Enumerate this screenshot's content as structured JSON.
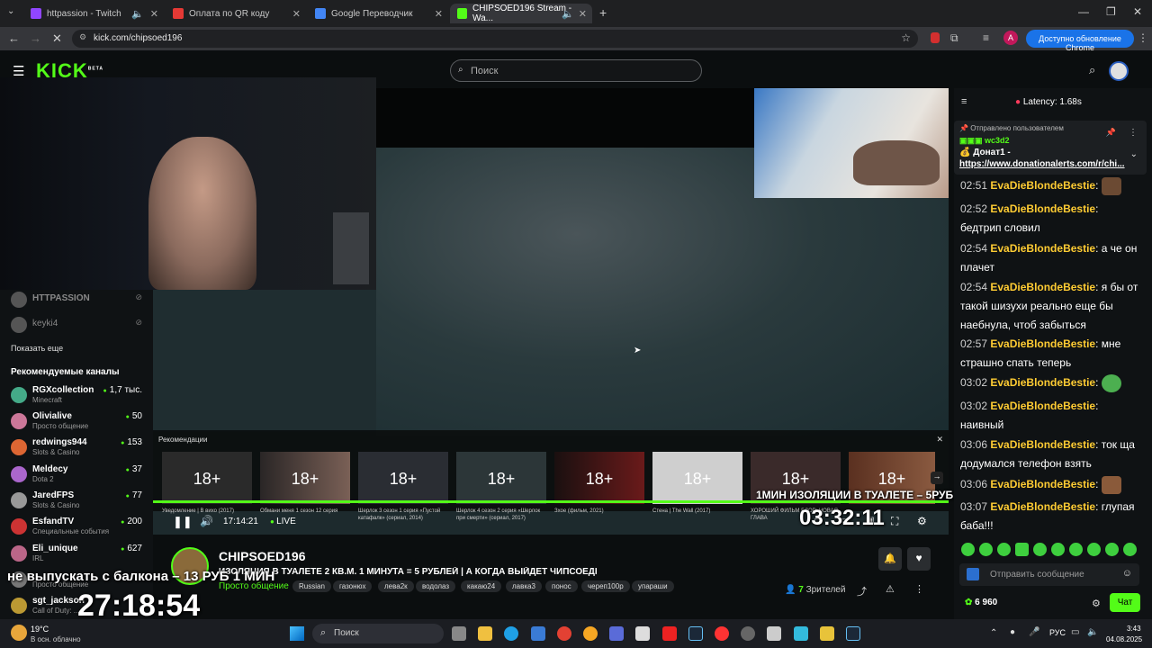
{
  "browser": {
    "tabs": [
      {
        "label": "httpassion - Twitch",
        "color": "#9146ff"
      },
      {
        "label": "Оплата по QR коду",
        "color": "#e53935"
      },
      {
        "label": "Google Переводчик",
        "color": "#4285f4"
      },
      {
        "label": "CHIPSOED196 Stream - Wa...",
        "color": "#53fc18"
      }
    ],
    "url": "kick.com/chipsoed196",
    "update_label": "Доступно обновление Chrome",
    "profile_initial": "A"
  },
  "kick": {
    "logo": "KICK",
    "logo_badge": "BETA",
    "search_placeholder": "Поиск"
  },
  "sidebar": {
    "followed": [
      {
        "name": "HTTPASSION",
        "color": "#888"
      },
      {
        "name": "keyki4",
        "color": "#888"
      }
    ],
    "show_more": "Показать еще",
    "recommended_title": "Рекомендуемые каналы",
    "recommended": [
      {
        "name": "RGXcollection",
        "category": "Minecraft",
        "viewers": "1,7 тыс.",
        "color": "#4a8"
      },
      {
        "name": "Olivialive",
        "category": "Просто общение",
        "viewers": "50",
        "color": "#c79"
      },
      {
        "name": "redwings944",
        "category": "Slots & Casino",
        "viewers": "153",
        "color": "#d63"
      },
      {
        "name": "Meldecy",
        "category": "Dota 2",
        "viewers": "37",
        "color": "#a6c"
      },
      {
        "name": "JaredFPS",
        "category": "Slots & Casino",
        "viewers": "77",
        "color": "#999"
      },
      {
        "name": "EsfandTV",
        "category": "Специальные события",
        "viewers": "200",
        "color": "#c33"
      },
      {
        "name": "Eli_unique",
        "category": "IRL",
        "viewers": "627",
        "color": "#b68"
      },
      {
        "name": "",
        "category": "Просто общение",
        "viewers": "",
        "color": "#777"
      },
      {
        "name": "sgt_jackson",
        "category": "Call of Duty: ...",
        "viewers": "",
        "color": "#b93"
      }
    ]
  },
  "player": {
    "recommendations_label": "Рекомендации",
    "rec_age": "18+",
    "rec_captions": [
      "Уведомление | В вихо (2017)",
      "Обмани меня 1 сезон 12 серия",
      "Шерлок 3 сезон 1 серия «Пустой катафалк» (сериал, 2014)",
      "Шерлок 4 сезон 2 серия «Шерлок при смерти» (сериал, 2017)",
      "Зхое (фильм, 2021)",
      "Стена | The Wall (2017)",
      "ХОРОШИЙ ФИЛЬМ БЛОР: НОВАЯ ГЛАВА"
    ],
    "rec_colors": [
      "#2a2a2a",
      "#3a2a26",
      "#2a2d33",
      "#2c3638",
      "#4a1a1a",
      "#cfcfcf",
      "#3a2a2a",
      "#6a3a2a"
    ],
    "timestamp": "17:14:21",
    "live_label": "LIVE",
    "overlay_toilet": "1МИН ИЗОЛЯЦИИ В ТУАЛЕТЕ – 5РУБ",
    "overlay_timer": "03:32:11",
    "overlay_balcony": "не выпускать с балкона – 13 РУБ 1 МИН",
    "overlay_big_timer": "27:18:54",
    "progress": 1.0
  },
  "stream": {
    "channel": "CHIPSOED196",
    "title": "ИЗОЛЯЦИЯ В ТУАЛЕТЕ 2 КВ.М. 1 МИНУТА = 5 РУБЛЕЙ | А КОГДА ВЫЙДЕТ ЧИПСОЕДЕ",
    "category": "Просто общение",
    "tags": [
      "Russian",
      "газонюх",
      "лева2к",
      "водолаз",
      "какаю24",
      "лавка3",
      "понос",
      "череп100р",
      "упараши"
    ],
    "viewers": "7",
    "viewers_label": "Зрителей"
  },
  "chat": {
    "latency": "Latency: 1.68s",
    "pinned": {
      "label": "Отправлено пользователем",
      "user": "wc3d2",
      "text": "Донат1 -",
      "link": "https://www.donationalerts.com/r/chi..."
    },
    "messages": [
      {
        "time": "02:51",
        "user": "EvaDieBlondeBestie",
        "text": "",
        "emote": "#6b4a33"
      },
      {
        "time": "02:52",
        "user": "EvaDieBlondeBestie",
        "text": "бедтрип словил",
        "emote": ""
      },
      {
        "time": "02:54",
        "user": "EvaDieBlondeBestie",
        "text": "а че он плачет",
        "emote": ""
      },
      {
        "time": "02:54",
        "user": "EvaDieBlondeBestie",
        "text": "я бы от такой шизухи реально еще бы наебнула, чтоб забыться",
        "emote": ""
      },
      {
        "time": "02:57",
        "user": "EvaDieBlondeBestie",
        "text": "мне страшно спать теперь",
        "emote": ""
      },
      {
        "time": "03:02",
        "user": "EvaDieBlondeBestie",
        "text": "",
        "emote": "#4caf50"
      },
      {
        "time": "03:02",
        "user": "EvaDieBlondeBestie",
        "text": "наивный",
        "emote": ""
      },
      {
        "time": "03:06",
        "user": "EvaDieBlondeBestie",
        "text": "ток ща додумался телефон взять",
        "emote": ""
      },
      {
        "time": "03:06",
        "user": "EvaDieBlondeBestie",
        "text": "",
        "emote": "#8a5a3a"
      },
      {
        "time": "03:07",
        "user": "EvaDieBlondeBestie",
        "text": "глупая баба!!!",
        "emote": ""
      }
    ],
    "input_placeholder": "Отправить сообщение",
    "points": "6 960",
    "send_label": "Чат"
  },
  "taskbar": {
    "weather_temp": "19°C",
    "weather_desc": "В осн. облачно",
    "search_label": "Поиск",
    "lang": "РУС",
    "time": "3:43",
    "date": "04.08.2025"
  }
}
